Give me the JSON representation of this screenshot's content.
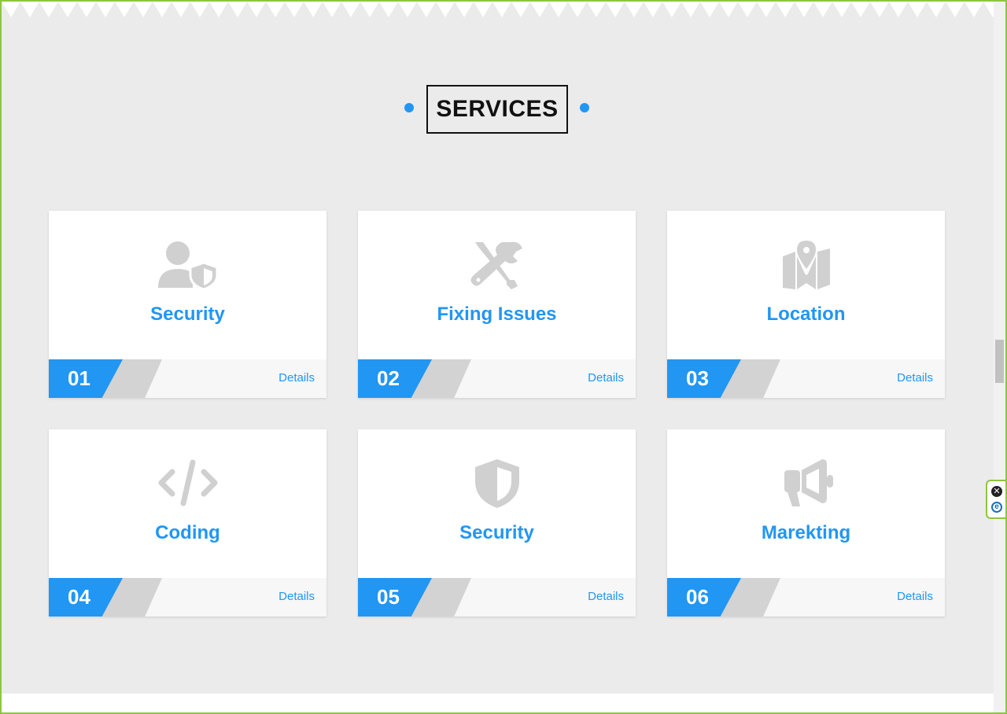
{
  "section": {
    "title": "SERVICES",
    "accent_color": "#2196f3"
  },
  "services": [
    {
      "number": "01",
      "title": "Security",
      "details_label": "Details",
      "icon": "user-shield-icon"
    },
    {
      "number": "02",
      "title": "Fixing Issues",
      "details_label": "Details",
      "icon": "tools-icon"
    },
    {
      "number": "03",
      "title": "Location",
      "details_label": "Details",
      "icon": "map-marker-icon"
    },
    {
      "number": "04",
      "title": "Coding",
      "details_label": "Details",
      "icon": "code-icon"
    },
    {
      "number": "05",
      "title": "Security",
      "details_label": "Details",
      "icon": "shield-icon"
    },
    {
      "number": "06",
      "title": "Marekting",
      "details_label": "Details",
      "icon": "megaphone-icon"
    }
  ],
  "extension_widget": {
    "close_icon": "close-icon",
    "logo_icon": "eset-logo-icon"
  }
}
